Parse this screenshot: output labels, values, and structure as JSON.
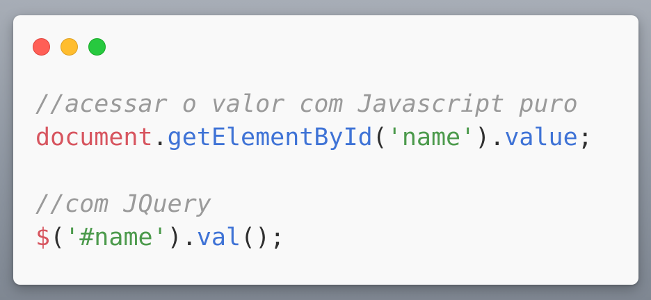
{
  "window": {
    "controls": [
      {
        "name": "close",
        "color": "#ff5f56"
      },
      {
        "name": "minimize",
        "color": "#ffbd2e"
      },
      {
        "name": "maximize",
        "color": "#27c93f"
      }
    ]
  },
  "code": {
    "line1": {
      "comment": "//acessar o valor com Javascript puro"
    },
    "line2": {
      "object": "document",
      "dot1": ".",
      "method": "getElementById",
      "open_paren": "(",
      "string": "'name'",
      "close_paren": ")",
      "dot2": ".",
      "property": "value",
      "semicolon": ";"
    },
    "line4": {
      "comment": "//com JQuery"
    },
    "line5": {
      "object": "$",
      "open_paren": "(",
      "string": "'#name'",
      "close_paren": ")",
      "dot": ".",
      "method": "val",
      "call_parens": "()",
      "semicolon": ";"
    }
  },
  "colors": {
    "comment": "#9a9a9a",
    "object": "#d7555f",
    "function": "#3f73d6",
    "string": "#4c9a4c",
    "punctuation": "#2f2f2f",
    "window_bg": "#f9f9f9"
  }
}
